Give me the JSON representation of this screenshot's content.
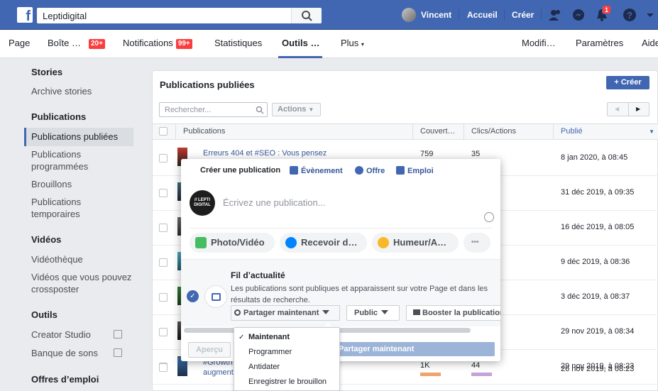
{
  "topbar": {
    "search_value": "Leptidigital",
    "user_name": "Vincent",
    "home_label": "Accueil",
    "create_label": "Créer",
    "notif_count": "1"
  },
  "page_nav": {
    "items": [
      {
        "label": "Page"
      },
      {
        "label": "Boîte …",
        "badge": "20+"
      },
      {
        "label": "Notifications",
        "badge": "99+"
      },
      {
        "label": "Statistiques"
      },
      {
        "label": "Outils …"
      },
      {
        "label": "Plus"
      },
      {
        "label": "Modifi…"
      },
      {
        "label": "Paramètres"
      },
      {
        "label": "Aide"
      }
    ]
  },
  "sidebar": {
    "sections": [
      {
        "heading": "Stories",
        "items": [
          "Archive stories"
        ]
      },
      {
        "heading": "Publications",
        "items": [
          "Publications publiées",
          "Publications programmées",
          "Brouillons",
          "Publications temporaires"
        ]
      },
      {
        "heading": "Vidéos",
        "items": [
          "Vidéothèque",
          "Vidéos que vous pouvez crossposter"
        ]
      },
      {
        "heading": "Outils",
        "items": [
          "Creator Studio",
          "Banque de sons"
        ]
      },
      {
        "heading": "Offres d’emploi",
        "items": []
      }
    ]
  },
  "panel": {
    "title": "Publications publiées",
    "create_button": "+ Créer",
    "search_placeholder": "Rechercher...",
    "actions_label": "Actions",
    "columns": [
      "Publications",
      "Couvert…",
      "Clics/Actions",
      "Publié"
    ],
    "rows": [
      {
        "title": "Erreurs 404 et #SEO : Vous pensez",
        "coverage": "759",
        "clicks": "35",
        "date": "8 jan 2020, à 08:45"
      },
      {
        "title": "",
        "coverage": "",
        "clicks": "",
        "date": "31 déc 2019, à 09:35"
      },
      {
        "title": "",
        "coverage": "",
        "clicks": "",
        "date": "16 déc 2019, à 08:05"
      },
      {
        "title": "",
        "coverage": "",
        "clicks": "",
        "date": "9 déc 2019, à 08:36"
      },
      {
        "title": "",
        "coverage": "",
        "clicks": "",
        "date": "3 déc 2019, à 08:37"
      },
      {
        "title": "",
        "coverage": "",
        "clicks": "",
        "date": "29 nov 2019, à 08:34"
      },
      {
        "title": "",
        "coverage": "",
        "clicks": "",
        "date": "29 nov 2019, à 08:23"
      },
      {
        "title": "#Growth… augment…",
        "coverage": "1K",
        "clicks": "44",
        "date": "26 nov 2019, à 08:23"
      }
    ]
  },
  "composer": {
    "tabs": [
      "Créer une publication",
      "Évènement",
      "Offre",
      "Emploi"
    ],
    "avatar_text": "// LEPTI DIGITAL",
    "placeholder": "Écrivez une publication...",
    "actions": [
      "Photo/Vidéo",
      "Recevoir d…",
      "Humeur/A…",
      "•••"
    ],
    "feed_title": "Fil d’actualité",
    "feed_desc": "Les publications sont publiques et apparaissent sur votre Page et dans les résultats de recherche.",
    "share_now_label": "Partager maintenant",
    "audience_label": "Public",
    "boost_label": "Booster la publication",
    "preview_label": "Aperçu",
    "submit_label": "Partager maintenant"
  },
  "dropdown": {
    "options": [
      "Maintenant",
      "Programmer",
      "Antidater",
      "Enregistrer le brouillon"
    ],
    "selected": "Maintenant"
  }
}
